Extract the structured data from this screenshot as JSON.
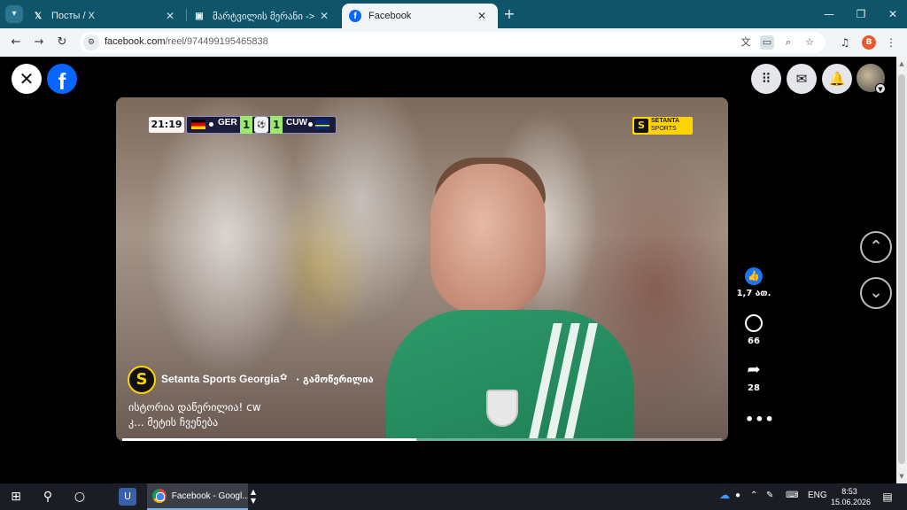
{
  "browser": {
    "tabs": [
      {
        "title": "Посты / X",
        "favicon": "x-icon"
      },
      {
        "title": "მარტვილის მერანი -> თბილ",
        "favicon": "page-icon"
      },
      {
        "title": "Facebook",
        "favicon": "facebook-icon",
        "active": true
      }
    ],
    "url_host": "facebook.com",
    "url_path": "/reel/974499195465838",
    "profile_initial": "B"
  },
  "video": {
    "clock": "21:19",
    "home_team": "GER",
    "home_score": "1",
    "away_score": "1",
    "away_team": "CUW",
    "broadcaster_line1": "SETANTA",
    "broadcaster_line2": "SPORTS",
    "channel_name": "Setanta Sports Georgia",
    "follow_status": "· გამოწერილია",
    "caption_line1": "ისტორია დაწერილია! cw",
    "caption_line2": "კ... მეტის ჩვენება",
    "progress_fraction": 0.49
  },
  "actions": {
    "likes": "1,7 ათ.",
    "comments": "66",
    "shares": "28"
  },
  "taskbar": {
    "active_app_label": "Facebook - Googl...",
    "language": "ENG",
    "time": "8:53",
    "date": "15.06.2026"
  },
  "colors": {
    "tabstrip": "#0f5469",
    "facebook_blue": "#0866ff",
    "setanta_yellow": "#ffd400",
    "jersey_green": "#2e9a6c"
  }
}
